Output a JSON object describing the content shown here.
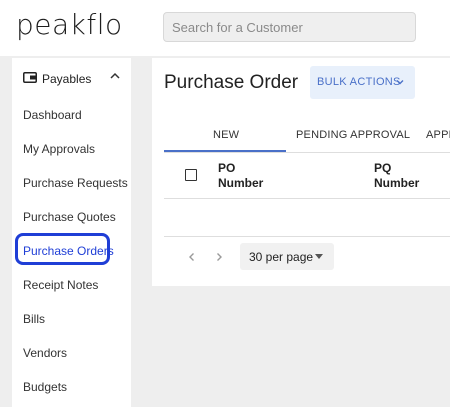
{
  "app": {
    "logo": "peakflo"
  },
  "search": {
    "placeholder": "Search for a Customer",
    "value": ""
  },
  "sidebar": {
    "section_label": "Payables",
    "items": [
      {
        "label": "Dashboard"
      },
      {
        "label": "My Approvals"
      },
      {
        "label": "Purchase Requests"
      },
      {
        "label": "Purchase Quotes"
      },
      {
        "label": "Purchase Orders",
        "active": true
      },
      {
        "label": "Receipt Notes"
      },
      {
        "label": "Bills"
      },
      {
        "label": "Vendors"
      },
      {
        "label": "Budgets"
      }
    ]
  },
  "main": {
    "title": "Purchase Order",
    "bulk_actions_label": "BULK ACTIONS",
    "tabs": [
      {
        "label": "NEW",
        "active": true
      },
      {
        "label": "PENDING APPROVAL"
      },
      {
        "label": "APPR"
      }
    ],
    "table": {
      "columns": [
        {
          "label_line1": "PO",
          "label_line2": "Number"
        },
        {
          "label_line1": "PQ",
          "label_line2": "Number"
        }
      ]
    },
    "pagination": {
      "per_page": "30 per page"
    }
  },
  "colors": {
    "accent": "#1f3ed6",
    "button_bg": "#e8f0fb",
    "button_text": "#4a70c8"
  }
}
